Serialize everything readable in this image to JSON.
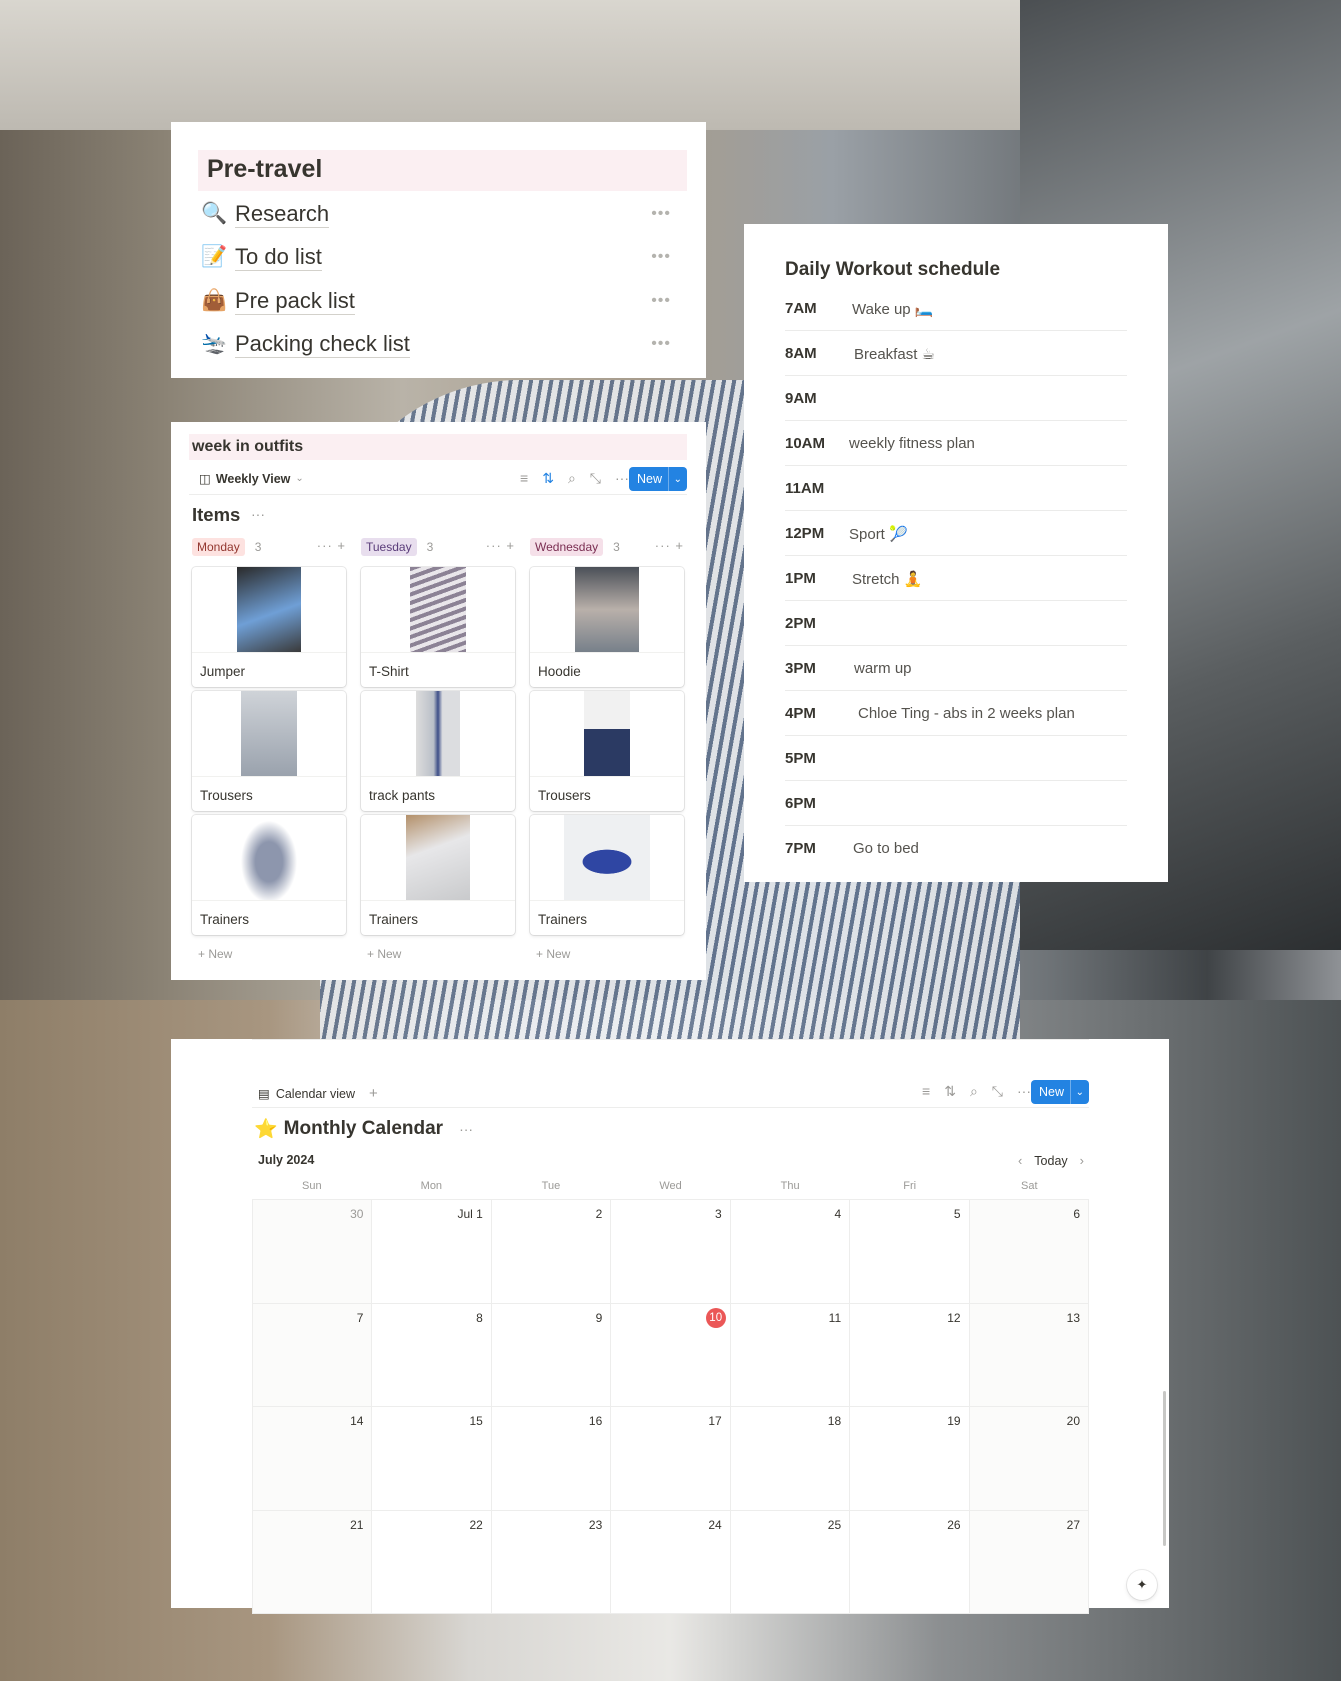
{
  "pretravel": {
    "heading": "Pre-travel",
    "items": [
      {
        "icon": "🔍",
        "label": "Research",
        "more": "•••"
      },
      {
        "icon": "📝",
        "label": "To do list",
        "more": "•••"
      },
      {
        "icon": "👜",
        "label": "Pre pack list",
        "more": "•••"
      },
      {
        "icon": "🛬",
        "label": "Packing check list",
        "more": "•••"
      }
    ]
  },
  "outfits": {
    "title": "week in outfits",
    "view_icon": "◫",
    "view_label": "Weekly View",
    "view_chevron": "⌄",
    "toolbar_icons": {
      "filter": "≡",
      "sort": "⇅",
      "search": "⌕",
      "expand": "⤡",
      "more": "···"
    },
    "new_label": "New",
    "new_dropdown": "⌄",
    "items_title": "Items",
    "items_more": "···",
    "columns": [
      {
        "name": "Monday",
        "count": "3",
        "tag_bg": "#fde2e0",
        "tag_fg": "#93372f",
        "cards": [
          {
            "label": "Jumper"
          },
          {
            "label": "Trousers"
          },
          {
            "label": "Trainers"
          }
        ],
        "new_label": "+ New"
      },
      {
        "name": "Tuesday",
        "count": "3",
        "tag_bg": "#e8deee",
        "tag_fg": "#5a3c7a",
        "cards": [
          {
            "label": "T-Shirt"
          },
          {
            "label": "track pants"
          },
          {
            "label": "Trainers"
          }
        ],
        "new_label": "+ New"
      },
      {
        "name": "Wednesday",
        "count": "3",
        "tag_bg": "#f5e0e9",
        "tag_fg": "#7a2e52",
        "cards": [
          {
            "label": "Hoodie"
          },
          {
            "label": "Trousers"
          },
          {
            "label": "Trainers"
          }
        ],
        "new_label": "+ New"
      }
    ],
    "col_actions": "··· +"
  },
  "workout": {
    "title": "Daily Workout schedule",
    "rows": [
      {
        "time": "7AM",
        "activity": "Wake up 🛏️"
      },
      {
        "time": "8AM",
        "activity": "Breakfast ☕"
      },
      {
        "time": "9AM",
        "activity": ""
      },
      {
        "time": "10AM",
        "activity": "weekly fitness plan"
      },
      {
        "time": "11AM",
        "activity": ""
      },
      {
        "time": "12PM",
        "activity": "Sport 🎾"
      },
      {
        "time": "1PM",
        "activity": "Stretch 🧘"
      },
      {
        "time": "2PM",
        "activity": ""
      },
      {
        "time": "3PM",
        "activity": "warm up"
      },
      {
        "time": "4PM",
        "activity": "Chloe Ting - abs in 2 weeks plan"
      },
      {
        "time": "5PM",
        "activity": ""
      },
      {
        "time": "6PM",
        "activity": ""
      },
      {
        "time": "7PM",
        "activity": "Go to bed"
      }
    ]
  },
  "calendar": {
    "view_icon": "▤",
    "view_label": "Calendar view",
    "add_view": "+",
    "toolbar_icons": {
      "filter": "≡",
      "sort": "⇅",
      "search": "⌕",
      "expand": "⤡",
      "more": "···"
    },
    "new_label": "New",
    "new_dropdown": "⌄",
    "title_icon": "⭐",
    "title": "Monthly Calendar",
    "title_more": "···",
    "month": "July 2024",
    "prev": "‹",
    "today_label": "Today",
    "next": "›",
    "weekdays": [
      "Sun",
      "Mon",
      "Tue",
      "Wed",
      "Thu",
      "Fri",
      "Sat"
    ],
    "today": "10",
    "weeks": [
      [
        "30",
        "Jul 1",
        "2",
        "3",
        "4",
        "5",
        "6"
      ],
      [
        "7",
        "8",
        "9",
        "10",
        "11",
        "12",
        "13"
      ],
      [
        "14",
        "15",
        "16",
        "17",
        "18",
        "19",
        "20"
      ],
      [
        "21",
        "22",
        "23",
        "24",
        "25",
        "26",
        "27"
      ]
    ],
    "ai_icon": "✦"
  }
}
